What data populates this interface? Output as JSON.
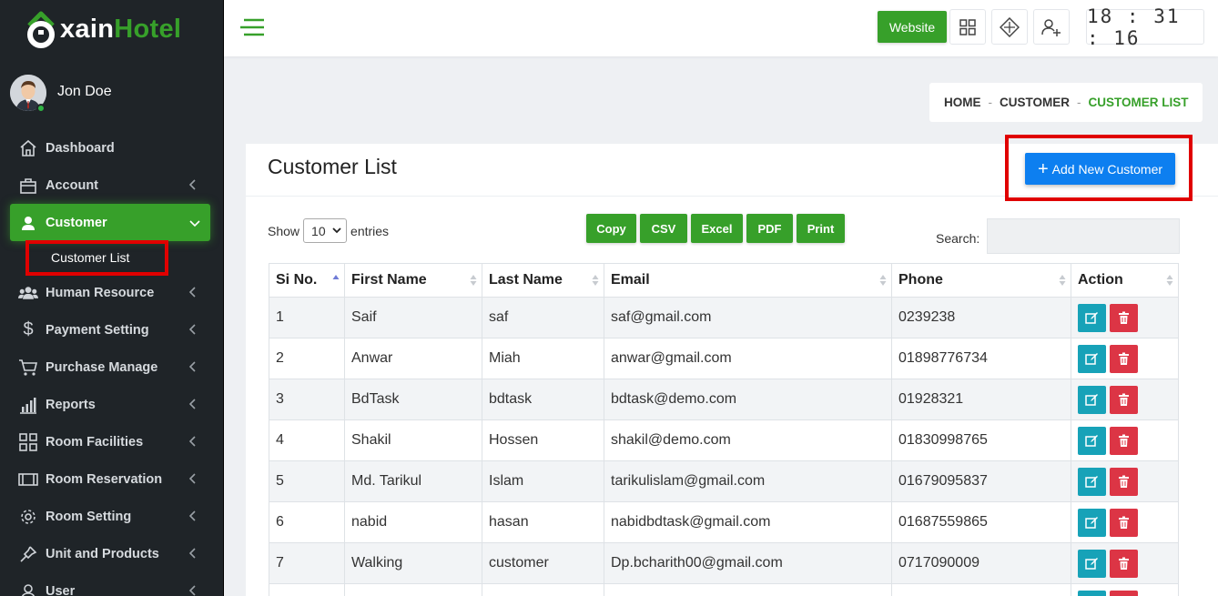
{
  "brand": {
    "name_part1": "xain",
    "name_part2": "Hotel",
    "green": "#37a02a"
  },
  "user": {
    "name": "Jon Doe",
    "status": "online"
  },
  "sidebar": {
    "items": [
      {
        "label": "Dashboard",
        "icon": "home-icon",
        "has_chevron": false
      },
      {
        "label": "Account",
        "icon": "briefcase-icon",
        "has_chevron": true
      },
      {
        "label": "Customer",
        "icon": "user-icon",
        "has_chevron": true,
        "active": true
      },
      {
        "label": "Human Resource",
        "icon": "users-icon",
        "has_chevron": true
      },
      {
        "label": "Payment Setting",
        "icon": "dollar-icon",
        "has_chevron": true
      },
      {
        "label": "Purchase Manage",
        "icon": "cart-icon",
        "has_chevron": true
      },
      {
        "label": "Reports",
        "icon": "bar-chart-icon",
        "has_chevron": true
      },
      {
        "label": "Room Facilities",
        "icon": "grid-icon",
        "has_chevron": true
      },
      {
        "label": "Room Reservation",
        "icon": "film-icon",
        "has_chevron": true
      },
      {
        "label": "Room Setting",
        "icon": "gear-icon",
        "has_chevron": true
      },
      {
        "label": "Unit and Products",
        "icon": "pin-icon",
        "has_chevron": true
      },
      {
        "label": "User",
        "icon": "user-outline-icon",
        "has_chevron": true
      }
    ],
    "sub_items": [
      {
        "label": "Customer List"
      }
    ]
  },
  "header": {
    "website_label": "Website",
    "clock": "18 : 31 : 16"
  },
  "breadcrumb": {
    "home": "HOME",
    "section": "CUSTOMER",
    "current": "CUSTOMER LIST"
  },
  "card": {
    "title": "Customer List",
    "add_label": "Add New Customer"
  },
  "table_controls": {
    "show_label": "Show",
    "page_size": "10",
    "entries_label": "entries",
    "search_label": "Search:",
    "export_buttons": [
      "Copy",
      "CSV",
      "Excel",
      "PDF",
      "Print"
    ]
  },
  "table": {
    "columns": [
      "Si No.",
      "First Name",
      "Last Name",
      "Email",
      "Phone",
      "Action"
    ],
    "rows": [
      [
        "1",
        "Saif",
        "saf",
        "saf@gmail.com",
        "0239238"
      ],
      [
        "2",
        "Anwar",
        "Miah",
        "anwar@gmail.com",
        "01898776734"
      ],
      [
        "3",
        "BdTask",
        "bdtask",
        "bdtask@demo.com",
        "01928321"
      ],
      [
        "4",
        "Shakil",
        "Hossen",
        "shakil@demo.com",
        "01830998765"
      ],
      [
        "5",
        "Md. Tarikul",
        "Islam",
        "tarikulislam@gmail.com",
        "01679095837"
      ],
      [
        "6",
        "nabid",
        "hasan",
        "nabidbdtask@gmail.com",
        "01687559865"
      ],
      [
        "7",
        "Walking",
        "customer",
        "Dp.bcharith00@gmail.com",
        "0717090009"
      ],
      [
        "",
        "",
        "",
        "",
        ""
      ]
    ]
  },
  "colors": {
    "accent": "#37a02a",
    "primary": "#0d7ff0",
    "edit": "#17a2b8",
    "delete": "#dc3545",
    "highlight": "#e00000"
  }
}
